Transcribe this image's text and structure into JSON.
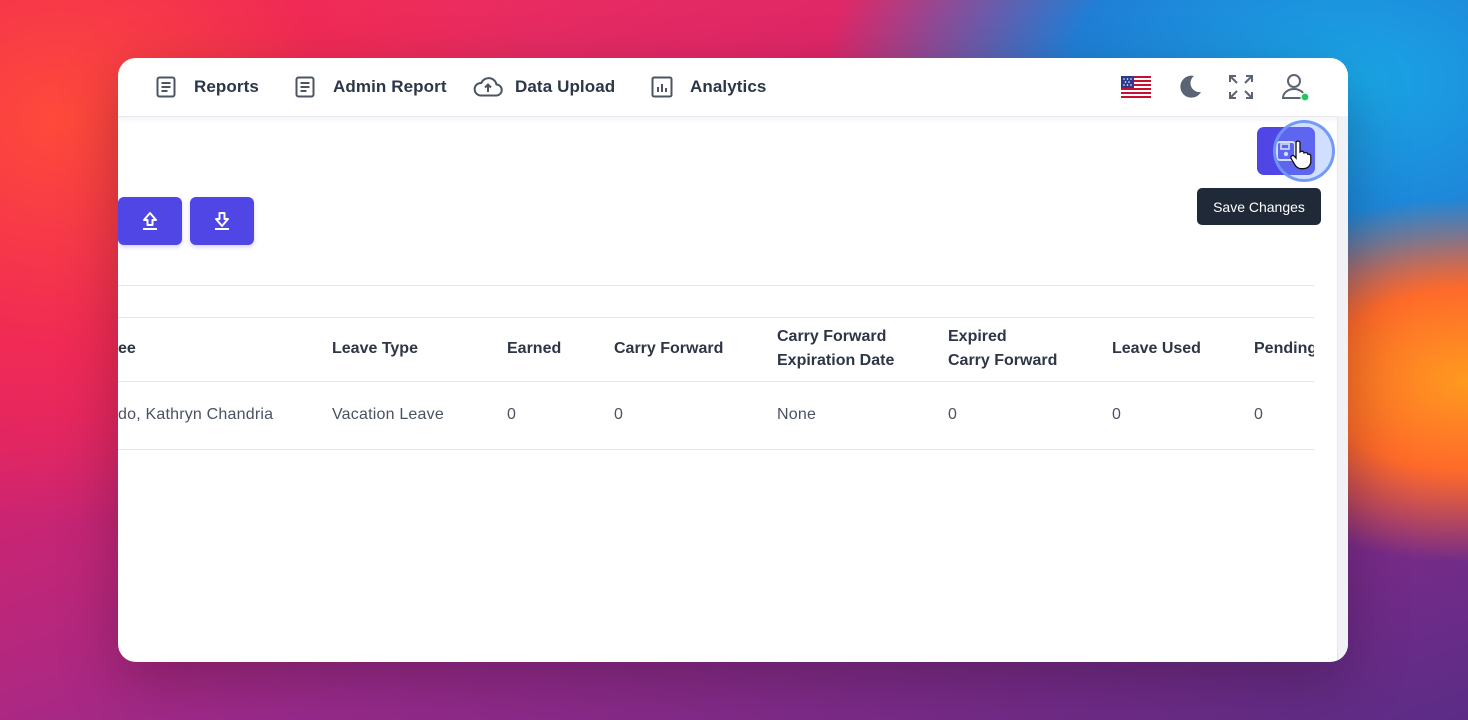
{
  "nav": {
    "items": [
      {
        "label": "Reports",
        "icon": "document-icon"
      },
      {
        "label": "Admin Report",
        "icon": "document-icon"
      },
      {
        "label": "Data Upload",
        "icon": "cloud-upload-icon"
      },
      {
        "label": "Analytics",
        "icon": "analytics-icon"
      }
    ]
  },
  "toolbar": {
    "save_tooltip": "Save Changes"
  },
  "table": {
    "headers": [
      {
        "line1": "ee",
        "line2": ""
      },
      {
        "line1": "Leave Type",
        "line2": ""
      },
      {
        "line1": "Earned",
        "line2": ""
      },
      {
        "line1": "Carry Forward",
        "line2": ""
      },
      {
        "line1": "Carry Forward",
        "line2": "Expiration Date"
      },
      {
        "line1": "Expired",
        "line2": "Carry Forward"
      },
      {
        "line1": "Leave Used",
        "line2": ""
      },
      {
        "line1": "Pending",
        "line2": ""
      }
    ],
    "rows": [
      [
        "do, Kathryn Chandria",
        "Vacation Leave",
        "0",
        "0",
        "None",
        "0",
        "0",
        "0"
      ]
    ]
  },
  "colors": {
    "accent": "#4f46e5",
    "status_online": "#22c55e",
    "tooltip_bg": "#1f2937"
  }
}
